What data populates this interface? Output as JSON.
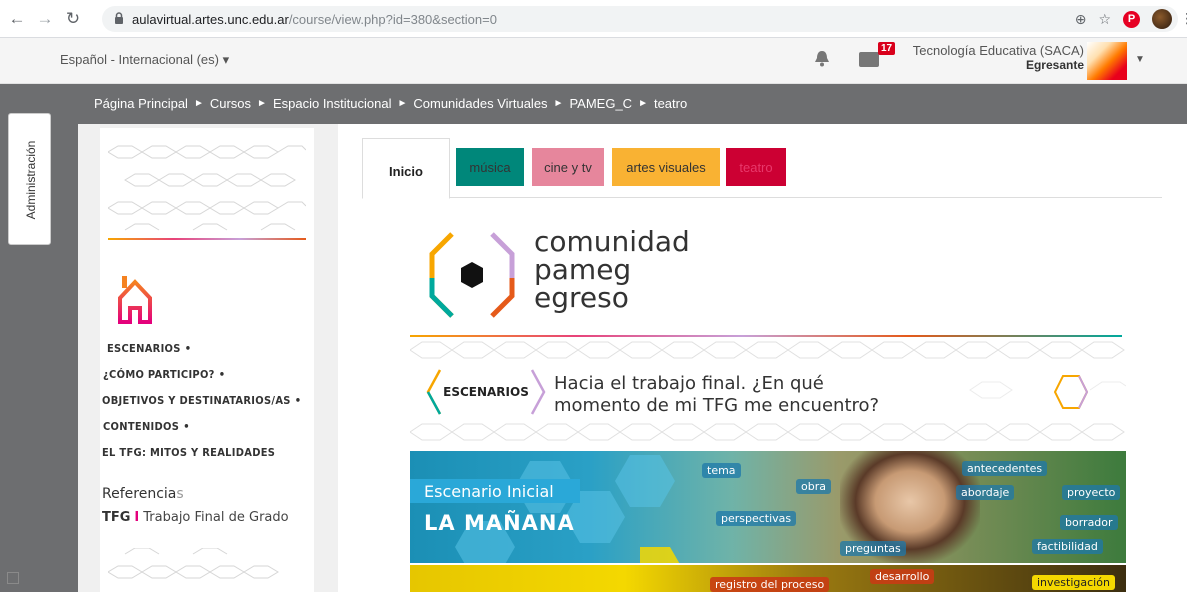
{
  "browser": {
    "url_host": "aulavirtual.artes.unc.edu.ar",
    "url_path": "/course/view.php?id=380&section=0",
    "icons": [
      "back-icon",
      "forward-icon",
      "reload-icon",
      "lock-icon",
      "zoom-icon",
      "star-icon",
      "pinterest-icon",
      "profile-avatar",
      "more-icon"
    ]
  },
  "header": {
    "language": "Español - Internacional (es) ▾",
    "message_count": "17",
    "user_name": "Tecnología Educativa (SACA)",
    "user_role": "Egresante"
  },
  "breadcrumb": {
    "items": [
      "Página Principal",
      "Cursos",
      "Espacio Institucional",
      "Comunidades Virtuales",
      "PAMEG_C",
      "teatro"
    ],
    "separator": "►"
  },
  "admin_tab": {
    "label": "Administración"
  },
  "sidebar": {
    "menu": [
      {
        "label": "ESCENARIOS",
        "dot": "•"
      },
      {
        "label": "¿CÓMO PARTICIPO?",
        "dot": "•"
      },
      {
        "label": "OBJETIVOS Y DESTINATARIOS/AS",
        "dot": "•"
      },
      {
        "label": "CONTENIDOS",
        "dot": "•"
      },
      {
        "label": "EL TFG: MITOS Y REALIDADES",
        "dot": ""
      }
    ],
    "refs_title_main": "Referencia",
    "refs_title_end": "s",
    "refs_abbr": "TFG",
    "refs_bar": "I",
    "refs_desc": "Trabajo Final de Grado"
  },
  "tabs": [
    {
      "label": "Inicio",
      "color": "#ffffff"
    },
    {
      "label": "música",
      "color": "#00877a"
    },
    {
      "label": "cine y tv",
      "color": "#e6869c"
    },
    {
      "label": "artes visuales",
      "color": "#f9b233"
    },
    {
      "label": "teatro",
      "color": "#cc0033"
    }
  ],
  "logo": {
    "line1": "comunidad",
    "line2": "pameg",
    "line3": "egreso"
  },
  "escenarios_banner": {
    "badge": "ESCENARIOS",
    "line1": "Hacia el trabajo final. ¿En qué",
    "line2": "momento de mi TFG me encuentro?"
  },
  "escenario_image": {
    "tag": "Escenario Inicial",
    "title": "LA MAÑANA",
    "chips": [
      "tema",
      "obra",
      "perspectivas",
      "preguntas",
      "antecedentes",
      "abordaje",
      "proyecto",
      "borrador",
      "factibilidad"
    ]
  },
  "escenario_strip": {
    "chips": [
      "registro del proceso",
      "desarrollo",
      "investigación"
    ]
  }
}
